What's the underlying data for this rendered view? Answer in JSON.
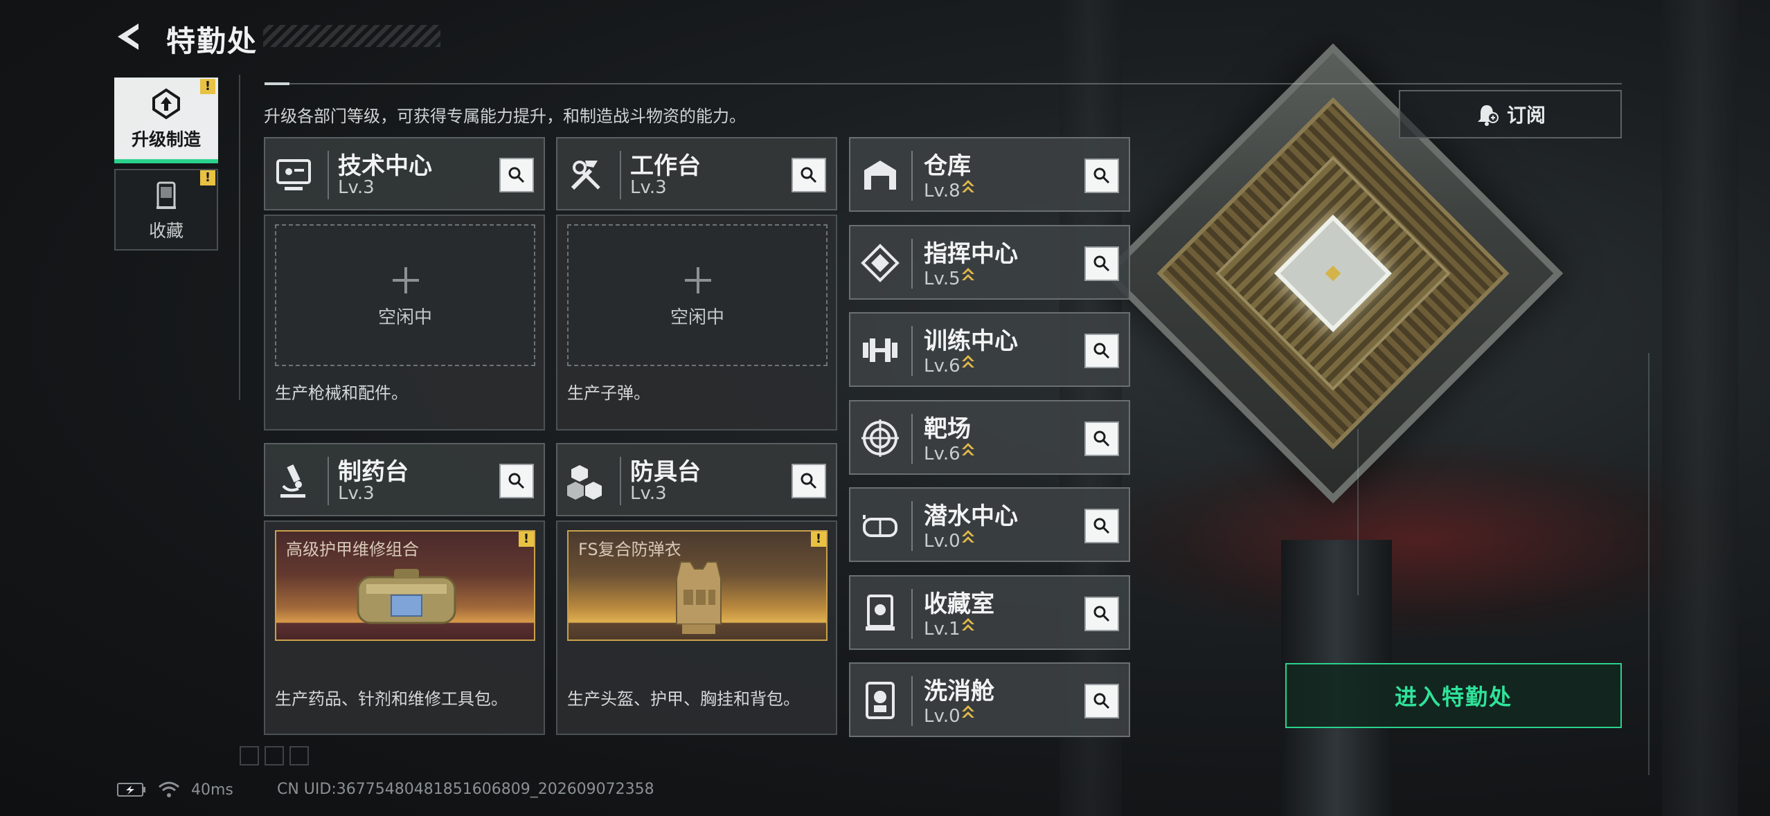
{
  "header": {
    "title": "特勤处",
    "intro": "升级各部门等级，可获得专属能力提升，和制造战斗物资的能力。"
  },
  "nav": [
    {
      "label": "升级制造",
      "active": true,
      "icon": "upgrade-icon",
      "alert": "!"
    },
    {
      "label": "收藏",
      "active": false,
      "icon": "collection-icon",
      "alert": "!"
    }
  ],
  "workbenches": [
    {
      "name": "技术中心",
      "level": "Lv.3",
      "icon": "monitor-icon",
      "status": "空闲中",
      "desc": "生产枪械和配件。"
    },
    {
      "name": "工作台",
      "level": "Lv.3",
      "icon": "tools-icon",
      "status": "空闲中",
      "desc": "生产子弹。"
    },
    {
      "name": "制药台",
      "level": "Lv.3",
      "icon": "microscope-icon",
      "item": "高级护甲维修组合",
      "alert": "!",
      "desc": "生产药品、针剂和维修工具包。"
    },
    {
      "name": "防具台",
      "level": "Lv.3",
      "icon": "armor-blocks-icon",
      "item": "FS复合防弹衣",
      "alert": "!",
      "desc": "生产头盔、护甲、胸挂和背包。"
    }
  ],
  "rooms": [
    {
      "name": "仓库",
      "level": "Lv.8",
      "icon": "warehouse-icon"
    },
    {
      "name": "指挥中心",
      "level": "Lv.5",
      "icon": "command-icon"
    },
    {
      "name": "训练中心",
      "level": "Lv.6",
      "icon": "dumbbell-icon"
    },
    {
      "name": "靶场",
      "level": "Lv.6",
      "icon": "target-icon"
    },
    {
      "name": "潜水中心",
      "level": "Lv.0",
      "icon": "diving-mask-icon"
    },
    {
      "name": "收藏室",
      "level": "Lv.1",
      "icon": "display-case-icon"
    },
    {
      "name": "洗消舱",
      "level": "Lv.0",
      "icon": "decontamination-icon"
    }
  ],
  "subscribe": {
    "label": "订阅"
  },
  "enter": {
    "label": "进入特勤处"
  },
  "footer": {
    "ping": "40ms",
    "uid": "CN UID:3677548048185160680​9_202609072358"
  },
  "colors": {
    "accent": "#2bd28c",
    "alert": "#e9c243",
    "upgrade": "#e0b84a"
  }
}
